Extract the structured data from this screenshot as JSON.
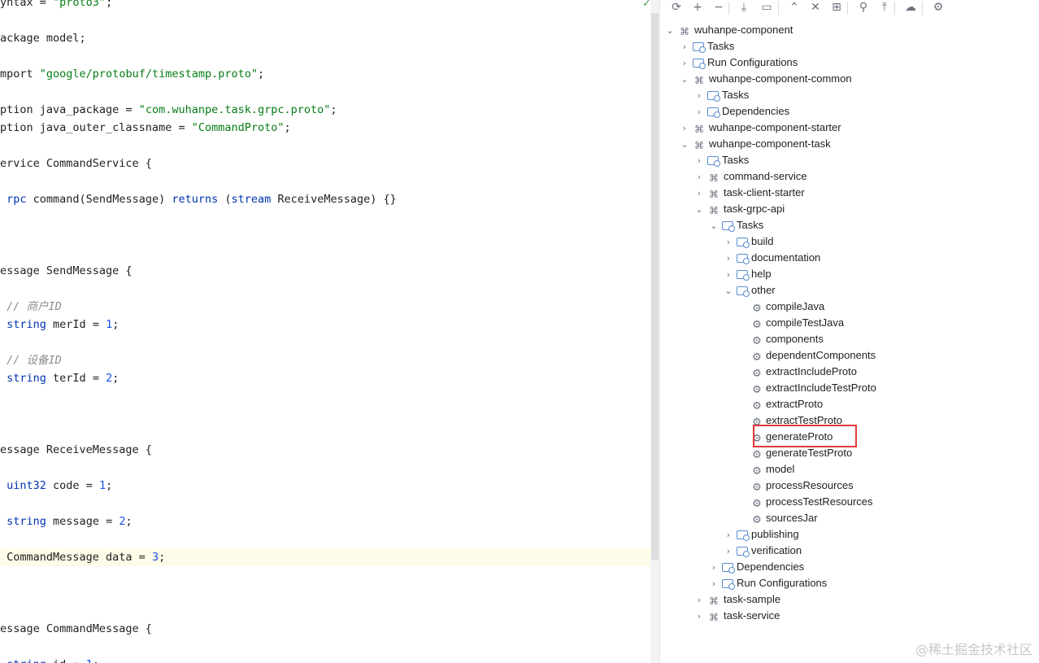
{
  "editor": {
    "status_icon": "check-icon",
    "lines": [
      {
        "segments": [
          {
            "t": "yntax = "
          },
          {
            "t": "\"proto3\"",
            "c": "str"
          },
          {
            "t": ";"
          }
        ]
      },
      {
        "segments": [
          {
            "t": "ackage model;"
          }
        ]
      },
      {
        "segments": [
          {
            "t": "mport "
          },
          {
            "t": "\"google/protobuf/timestamp.proto\"",
            "c": "str"
          },
          {
            "t": ";"
          }
        ]
      },
      {
        "segments": [
          {
            "t": "ption java_package = "
          },
          {
            "t": "\"com.wuhanpe.task.grpc.proto\"",
            "c": "str"
          },
          {
            "t": ";"
          }
        ]
      },
      {
        "segments": [
          {
            "t": "ption java_outer_classname = "
          },
          {
            "t": "\"CommandProto\"",
            "c": "str"
          },
          {
            "t": ";"
          }
        ]
      },
      {
        "segments": [
          {
            "t": "ervice CommandService {"
          }
        ]
      },
      {
        "segments": [
          {
            "t": " "
          },
          {
            "t": "rpc",
            "c": "kw"
          },
          {
            "t": " command(SendMessage) "
          },
          {
            "t": "returns",
            "c": "kw"
          },
          {
            "t": " ("
          },
          {
            "t": "stream",
            "c": "kw"
          },
          {
            "t": " ReceiveMessage) {}"
          }
        ]
      },
      {
        "segments": [
          {
            "t": "essage SendMessage {"
          }
        ]
      },
      {
        "segments": [
          {
            "t": " "
          },
          {
            "t": "// 商户ID",
            "c": "cmt"
          }
        ]
      },
      {
        "segments": [
          {
            "t": " "
          },
          {
            "t": "string",
            "c": "kw"
          },
          {
            "t": " merId = "
          },
          {
            "t": "1",
            "c": "num"
          },
          {
            "t": ";"
          }
        ]
      },
      {
        "segments": [
          {
            "t": " "
          },
          {
            "t": "// 设备ID",
            "c": "cmt"
          }
        ]
      },
      {
        "segments": [
          {
            "t": " "
          },
          {
            "t": "string",
            "c": "kw"
          },
          {
            "t": " terId = "
          },
          {
            "t": "2",
            "c": "num"
          },
          {
            "t": ";"
          }
        ]
      },
      {
        "segments": [
          {
            "t": "essage ReceiveMessage {"
          }
        ]
      },
      {
        "segments": [
          {
            "t": " "
          },
          {
            "t": "uint32",
            "c": "kw"
          },
          {
            "t": " code = "
          },
          {
            "t": "1",
            "c": "num"
          },
          {
            "t": ";"
          }
        ]
      },
      {
        "segments": [
          {
            "t": " "
          },
          {
            "t": "string",
            "c": "kw"
          },
          {
            "t": " message = "
          },
          {
            "t": "2",
            "c": "num"
          },
          {
            "t": ";"
          }
        ]
      },
      {
        "segments": [
          {
            "t": " CommandMessage data = "
          },
          {
            "t": "3",
            "c": "num"
          },
          {
            "t": ";"
          }
        ],
        "highlight": true
      },
      {
        "segments": [
          {
            "t": "essage CommandMessage {"
          }
        ]
      },
      {
        "segments": [
          {
            "t": " "
          },
          {
            "t": "string",
            "c": "kw"
          },
          {
            "t": " id = "
          },
          {
            "t": "1",
            "c": "num"
          },
          {
            "t": ";"
          }
        ]
      }
    ]
  },
  "gradle": {
    "toolbar": [
      {
        "name": "reload-icon",
        "glyph": "⟳"
      },
      {
        "name": "add-icon",
        "glyph": "+"
      },
      {
        "name": "remove-icon",
        "glyph": "−"
      },
      {
        "name": "download-icon",
        "glyph": "⤓"
      },
      {
        "name": "execute-task-icon",
        "glyph": "▭"
      },
      {
        "name": "expand-all-icon",
        "glyph": "⌃"
      },
      {
        "name": "collapse-all-icon",
        "glyph": "✕"
      },
      {
        "name": "link-project-icon",
        "glyph": "⊞"
      },
      {
        "name": "dependencies-icon",
        "glyph": "⚲"
      },
      {
        "name": "show-top-icon",
        "glyph": "⤒"
      },
      {
        "name": "offline-icon",
        "glyph": "☁"
      },
      {
        "name": "settings-icon",
        "glyph": "⚙"
      }
    ],
    "tree": [
      {
        "label": "wuhanpe-component",
        "chev": "⌄",
        "icon": "gradle"
      },
      {
        "label": "Tasks",
        "chev": "›",
        "icon": "folder"
      },
      {
        "label": "Run Configurations",
        "chev": "›",
        "icon": "folder"
      },
      {
        "label": "wuhanpe-component-common",
        "chev": "⌄",
        "icon": "gradle"
      },
      {
        "label": "Tasks",
        "chev": "›",
        "icon": "folder"
      },
      {
        "label": "Dependencies",
        "chev": "›",
        "icon": "folder"
      },
      {
        "label": "wuhanpe-component-starter",
        "chev": "›",
        "icon": "gradle"
      },
      {
        "label": "wuhanpe-component-task",
        "chev": "⌄",
        "icon": "gradle"
      },
      {
        "label": "Tasks",
        "chev": "›",
        "icon": "folder"
      },
      {
        "label": "command-service",
        "chev": "›",
        "icon": "gradle"
      },
      {
        "label": "task-client-starter",
        "chev": "›",
        "icon": "gradle"
      },
      {
        "label": "task-grpc-api",
        "chev": "⌄",
        "icon": "gradle"
      },
      {
        "label": "Tasks",
        "chev": "⌄",
        "icon": "folder"
      },
      {
        "label": "build",
        "chev": "›",
        "icon": "folder"
      },
      {
        "label": "documentation",
        "chev": "›",
        "icon": "folder"
      },
      {
        "label": "help",
        "chev": "›",
        "icon": "folder"
      },
      {
        "label": "other",
        "chev": "⌄",
        "icon": "folder"
      },
      {
        "label": "compileJava",
        "chev": "",
        "icon": "gear"
      },
      {
        "label": "compileTestJava",
        "chev": "",
        "icon": "gear"
      },
      {
        "label": "components",
        "chev": "",
        "icon": "gear"
      },
      {
        "label": "dependentComponents",
        "chev": "",
        "icon": "gear"
      },
      {
        "label": "extractIncludeProto",
        "chev": "",
        "icon": "gear"
      },
      {
        "label": "extractIncludeTestProto",
        "chev": "",
        "icon": "gear"
      },
      {
        "label": "extractProto",
        "chev": "",
        "icon": "gear"
      },
      {
        "label": "extractTestProto",
        "chev": "",
        "icon": "gear"
      },
      {
        "label": "generateProto",
        "chev": "",
        "icon": "gear",
        "selected": true
      },
      {
        "label": "generateTestProto",
        "chev": "",
        "icon": "gear"
      },
      {
        "label": "model",
        "chev": "",
        "icon": "gear"
      },
      {
        "label": "processResources",
        "chev": "",
        "icon": "gear"
      },
      {
        "label": "processTestResources",
        "chev": "",
        "icon": "gear"
      },
      {
        "label": "sourcesJar",
        "chev": "",
        "icon": "gear"
      },
      {
        "label": "publishing",
        "chev": "›",
        "icon": "folder"
      },
      {
        "label": "verification",
        "chev": "›",
        "icon": "folder"
      },
      {
        "label": "Dependencies",
        "chev": "›",
        "icon": "folder"
      },
      {
        "label": "Run Configurations",
        "chev": "›",
        "icon": "folder"
      },
      {
        "label": "task-sample",
        "chev": "›",
        "icon": "gradle"
      },
      {
        "label": "task-service",
        "chev": "›",
        "icon": "gradle"
      }
    ]
  },
  "watermark": "@稀土掘金技术社区",
  "highlight_color": "#e03a3a"
}
